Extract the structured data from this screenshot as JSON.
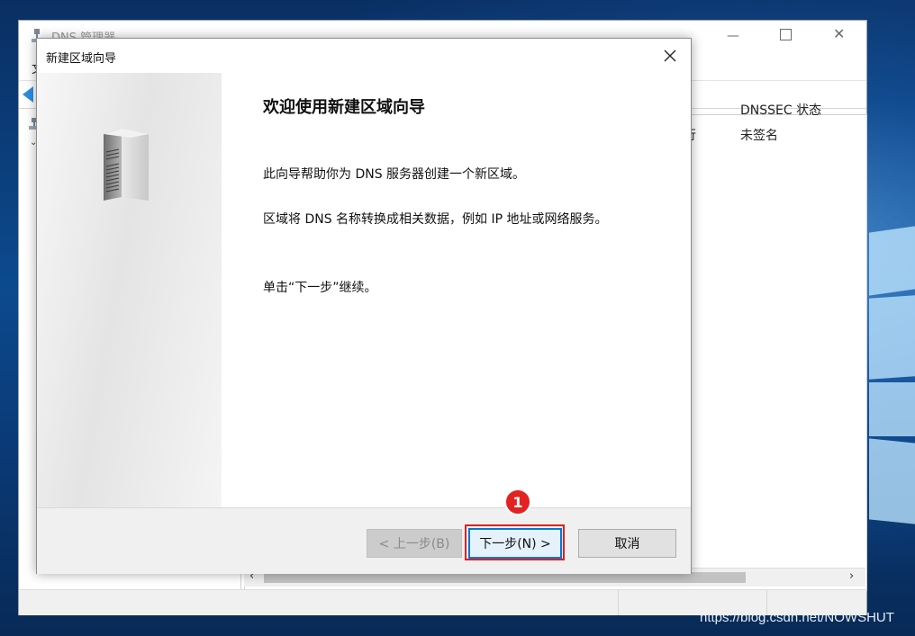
{
  "background_window": {
    "title": "DNS 管理器",
    "menu_first_item": "文",
    "list_column_header": "DNSSEC 状态",
    "list_cell_status": "运行",
    "list_cell_dnssec": "未签名"
  },
  "dialog": {
    "title": "新建区域向导",
    "heading": "欢迎使用新建区域向导",
    "paragraph1": "此向导帮助你为 DNS 服务器创建一个新区域。",
    "paragraph2": "区域将 DNS 名称转换成相关数据，例如 IP 地址或网络服务。",
    "paragraph3": "单击“下一步”继续。",
    "buttons": {
      "back": "< 上一步(B)",
      "next": "下一步(N) >",
      "cancel": "取消"
    }
  },
  "annotation": {
    "step_marker": "1"
  },
  "watermark": "https://blog.csdn.net/NOWSHUT",
  "colors": {
    "accent": "#0078d7",
    "highlight": "#e02020"
  }
}
